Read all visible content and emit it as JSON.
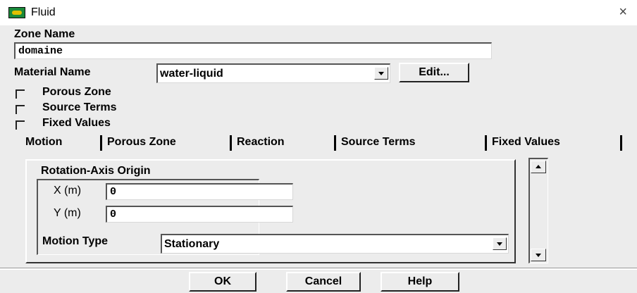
{
  "window": {
    "title": "Fluid",
    "icon": "fluent-app-icon",
    "close_glyph": "×"
  },
  "zone_name": {
    "label": "Zone Name",
    "value": "domaine"
  },
  "material": {
    "label": "Material Name",
    "value": "water-liquid",
    "edit_label": "Edit..."
  },
  "options": [
    {
      "label": "Porous Zone",
      "checked": false
    },
    {
      "label": "Source Terms",
      "checked": false
    },
    {
      "label": "Fixed Values",
      "checked": false
    }
  ],
  "tabs": [
    {
      "label": "Motion",
      "active": true
    },
    {
      "label": "Porous Zone",
      "active": false
    },
    {
      "label": "Reaction",
      "active": false
    },
    {
      "label": "Source Terms",
      "active": false
    },
    {
      "label": "Fixed Values",
      "active": false
    }
  ],
  "motion": {
    "group_label": "Rotation-Axis Origin",
    "x_label": "X (m)",
    "x_value": "0",
    "y_label": "Y (m)",
    "y_value": "0",
    "motion_type_label": "Motion Type",
    "motion_type_value": "Stationary"
  },
  "buttons": {
    "ok": "OK",
    "cancel": "Cancel",
    "help": "Help"
  }
}
